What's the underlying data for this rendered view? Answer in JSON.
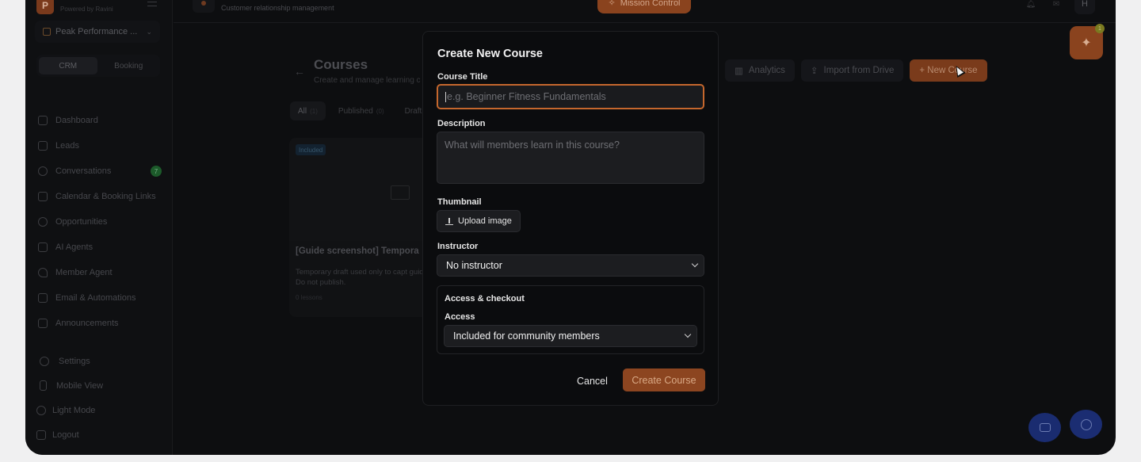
{
  "sidebar": {
    "brand_letter": "P",
    "brand_sub": "Powered by Ravini",
    "workspace": "Peak Performance ...",
    "segments": [
      "CRM",
      "Booking"
    ],
    "items": [
      {
        "label": "Dashboard",
        "icon": "home-icon"
      },
      {
        "label": "Leads",
        "icon": "users-icon"
      },
      {
        "label": "Conversations",
        "icon": "chat-icon",
        "badge": "7"
      },
      {
        "label": "Calendar & Booking Links",
        "icon": "calendar-icon"
      },
      {
        "label": "Opportunities",
        "icon": "dollar-icon"
      },
      {
        "label": "AI Agents",
        "icon": "monitor-icon"
      },
      {
        "label": "Member Agent",
        "icon": "heart-icon"
      },
      {
        "label": "Email & Automations",
        "icon": "mail-icon"
      },
      {
        "label": "Announcements",
        "icon": "mail-icon"
      }
    ],
    "bottom": [
      {
        "label": "Settings",
        "icon": "gear-icon"
      },
      {
        "label": "Mobile View",
        "icon": "phone-icon"
      },
      {
        "label": "Light Mode",
        "icon": "sun-icon"
      },
      {
        "label": "Logout",
        "icon": "logout-icon"
      }
    ]
  },
  "topbar": {
    "subtitle": "Customer relationship management",
    "mission": "Mission Control",
    "avatar": "H"
  },
  "page": {
    "title": "Courses",
    "subtitle": "Create and manage learning c",
    "tabs": [
      {
        "label": "All",
        "count": "(1)"
      },
      {
        "label": "Published",
        "count": "(0)"
      },
      {
        "label": "Draft",
        "count": ""
      }
    ],
    "actions": {
      "analytics": "Analytics",
      "import": "Import from Drive",
      "new_course": "+ New Course"
    },
    "card": {
      "badge": "Included",
      "title": "[Guide screenshot] Tempora",
      "desc": "Temporary draft used only to capt guide. Do not publish.",
      "lessons": "0 lessons"
    },
    "spark_badge": "1"
  },
  "modal": {
    "title": "Create New Course",
    "course_title_label": "Course Title",
    "course_title_placeholder": "e.g. Beginner Fitness Fundamentals",
    "description_label": "Description",
    "description_placeholder": "What will members learn in this course?",
    "thumbnail_label": "Thumbnail",
    "upload_label": "Upload image",
    "instructor_label": "Instructor",
    "instructor_value": "No instructor",
    "access_heading": "Access & checkout",
    "access_label": "Access",
    "access_value": "Included for community members",
    "cancel": "Cancel",
    "create": "Create Course"
  }
}
